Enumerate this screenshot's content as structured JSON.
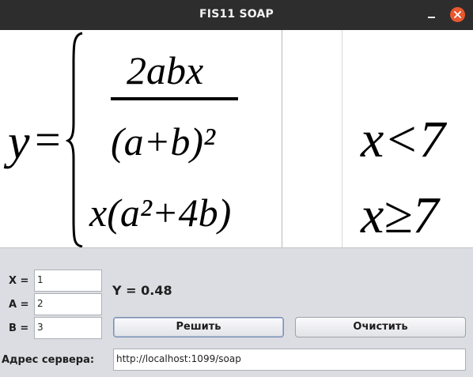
{
  "window": {
    "title": "FIS11 SOAP"
  },
  "formula": {
    "lhs": "y",
    "equals": "=",
    "case1_numerator": "2abx",
    "case1_denominator": "(a+b)²",
    "case1_condition": "x<7",
    "case2_expression": "x(a²+4b)",
    "case2_condition": "x≥7"
  },
  "form": {
    "x_label": "X =",
    "x_value": "1",
    "a_label": "A =",
    "a_value": "2",
    "b_label": "B =",
    "b_value": "3",
    "result_text": "Y = 0.48",
    "solve_button": "Решить",
    "clear_button": "Очистить",
    "server_label": "Адрес сервера:",
    "server_value": "http://localhost:1099/soap"
  },
  "icons": {
    "minimize": "minimize-icon",
    "close": "close-icon"
  },
  "colors": {
    "titlebar": "#2d2d2d",
    "close_button": "#e9572f",
    "form_background": "#dbdde2"
  }
}
